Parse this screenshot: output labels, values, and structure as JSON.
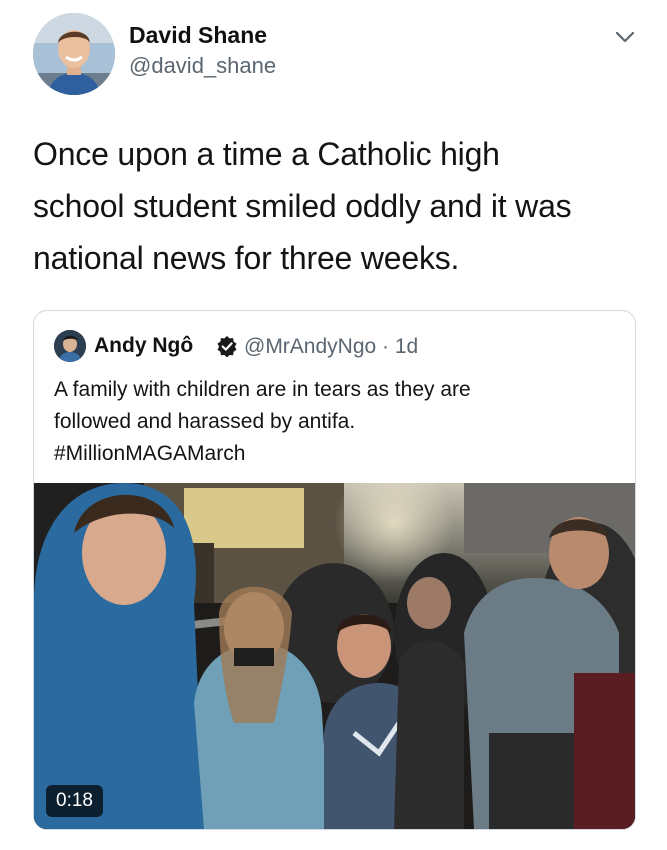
{
  "tweet": {
    "author_name": "David Shane",
    "author_handle": "@david_shane",
    "text_lines": [
      "Once upon a time a Catholic high",
      "school student smiled oddly and it was",
      "national news for three weeks."
    ]
  },
  "quoted_tweet": {
    "author_name": "Andy Ngô",
    "handle_and_time": "@MrAndyNgo · 1d",
    "text_lines": [
      "A family with children are in tears as they are",
      "followed and harassed by antifa.",
      "#MillionMAGAMarch"
    ],
    "video_duration": "0:18"
  },
  "icons": {
    "menu": "chevron-down-icon",
    "verified": "verified-badge-icon"
  },
  "colors": {
    "secondary_text": "#5b6670",
    "verified_badge": "#1a1a1a",
    "card_border": "#cfd9de"
  }
}
